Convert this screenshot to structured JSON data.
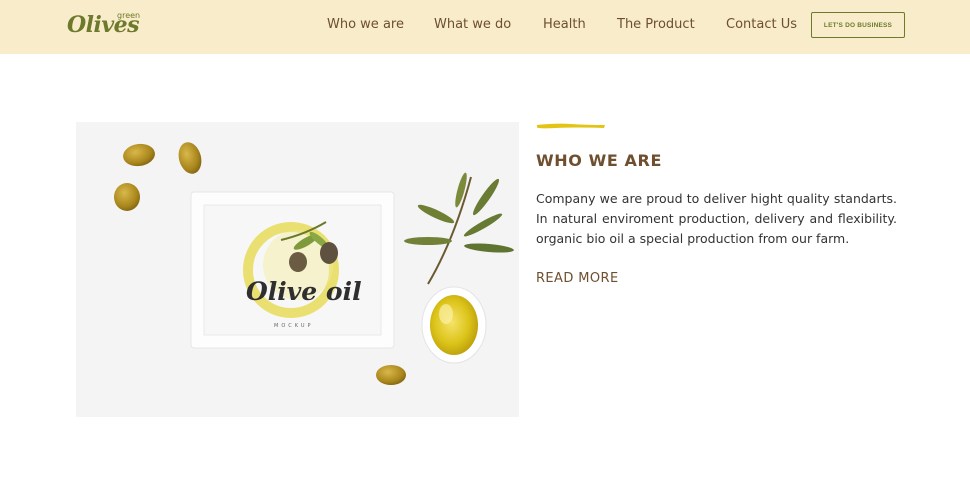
{
  "header": {
    "logo": {
      "main": "Olives",
      "sub": "green"
    },
    "nav": [
      {
        "label": "Who we are"
      },
      {
        "label": "What we do"
      },
      {
        "label": "Health"
      },
      {
        "label": "The Product"
      },
      {
        "label": "Contact Us"
      }
    ],
    "cta_label": "LET'S DO BUSINESS"
  },
  "photo": {
    "frame_text": "Olive oil",
    "frame_subtext": "MOCKUP"
  },
  "about": {
    "title": "WHO WE ARE",
    "body": "Company we are proud to deliver hight quality standarts. In natural enviroment production, delivery and flexibility. organic bio oil a special production from our farm.",
    "read_more": "READ MORE"
  },
  "colors": {
    "header_bg": "#f8ecca",
    "brand_green": "#6c7a2a",
    "brown": "#6e4f2f",
    "accent_yellow": "#e3c412"
  }
}
